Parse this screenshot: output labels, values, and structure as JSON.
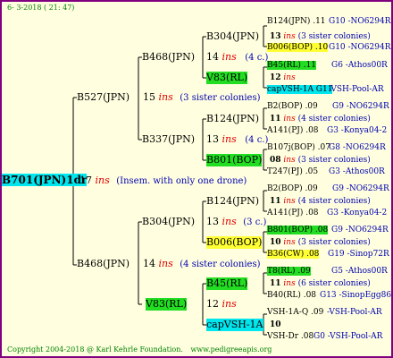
{
  "header": {
    "date": "6- 3-2018 ( 21: 47)"
  },
  "footer": {
    "copyright": "Copyright 2004-2018 @ Karl Kehrle Foundation.",
    "site": "www.pedigreeapis.org"
  },
  "root": {
    "name": "B701(JPN)1dr",
    "num": "17",
    "ins": "ins",
    "note": "(Insem. with only one drone)"
  },
  "g1": [
    {
      "name": "B527(JPN)",
      "num": "15",
      "ins": "ins",
      "note": "(3 sister colonies)"
    },
    {
      "name": "B468(JPN)",
      "num": "14",
      "ins": "ins",
      "note": "(4 sister colonies)"
    }
  ],
  "g2": [
    {
      "name": "B468(JPN)",
      "num": "14",
      "ins": "ins",
      "note": "(4 c.)"
    },
    {
      "name": "B337(JPN)",
      "num": "13",
      "ins": "ins",
      "note": "(4 c.)"
    },
    {
      "name": "B304(JPN)",
      "num": "13",
      "ins": "ins",
      "note": "(3 c.)"
    },
    {
      "name": "V83(RL)",
      "num": "12",
      "ins": "ins",
      "note": ""
    }
  ],
  "g3": [
    {
      "name": "B304(JPN)",
      "num": "13",
      "ins": "ins",
      "note": "(3 sister colonies)"
    },
    {
      "name": "V83(RL)",
      "num": "12",
      "ins": "ins",
      "note": ""
    },
    {
      "name": "B124(JPN)",
      "num": "11",
      "ins": "ins",
      "note": "(4 sister colonies)"
    },
    {
      "name": "B801(BOP)",
      "num": "08",
      "ins": "ins",
      "note": "(3 sister colonies)"
    },
    {
      "name": "B124(JPN)",
      "num": "11",
      "ins": "ins",
      "note": "(4 sister colonies)"
    },
    {
      "name": "B006(BOP)",
      "num": "10",
      "ins": "ins",
      "note": "(3 sister colonies)"
    },
    {
      "name": "B45(RL)",
      "num": "11",
      "ins": "ins",
      "note": "(6 sister colonies)"
    },
    {
      "name": "capVSH-1A",
      "num": "10",
      "ins": "",
      "note": ""
    }
  ],
  "g4": [
    {
      "name": "B124(JPN) .11",
      "tail": "G10 -NO6294R"
    },
    {
      "name": "B006(BOP) .10",
      "tail": "G10 -NO6294R"
    },
    {
      "name": "B45(RL) .11",
      "tail": "G6 -Athos00R"
    },
    {
      "name": "capVSH-1A G11",
      "tail": "-VSH-Pool-AR"
    },
    {
      "name": "B2(BOP) .09",
      "tail": "G9 -NO6294R"
    },
    {
      "name": "A141(PJ) .08",
      "tail": "G3 -Konya04-2"
    },
    {
      "name": "B107j(BOP) .07",
      "tail": "G8 -NO6294R"
    },
    {
      "name": "T247(PJ) .05",
      "tail": "G3 -Athos00R"
    },
    {
      "name": "B2(BOP) .09",
      "tail": "G9 -NO6294R"
    },
    {
      "name": "A141(PJ) .08",
      "tail": "G3 -Konya04-2"
    },
    {
      "name": "B801(BOP) .08",
      "tail": "G9 -NO6294R"
    },
    {
      "name": "B36(CW) .08",
      "tail": "G19 -Sinop72R"
    },
    {
      "name": "T8(RL) .09",
      "tail": "G5 -Athos00R"
    },
    {
      "name": "B40(RL) .08",
      "tail": "G13 -SinopEgg86R"
    },
    {
      "name": "VSH-1A-Q .09",
      "tail": "-VSH-Pool-AR"
    },
    {
      "name": "VSH-Dr .08",
      "tail": "G0 -VSH-Pool-AR"
    }
  ]
}
